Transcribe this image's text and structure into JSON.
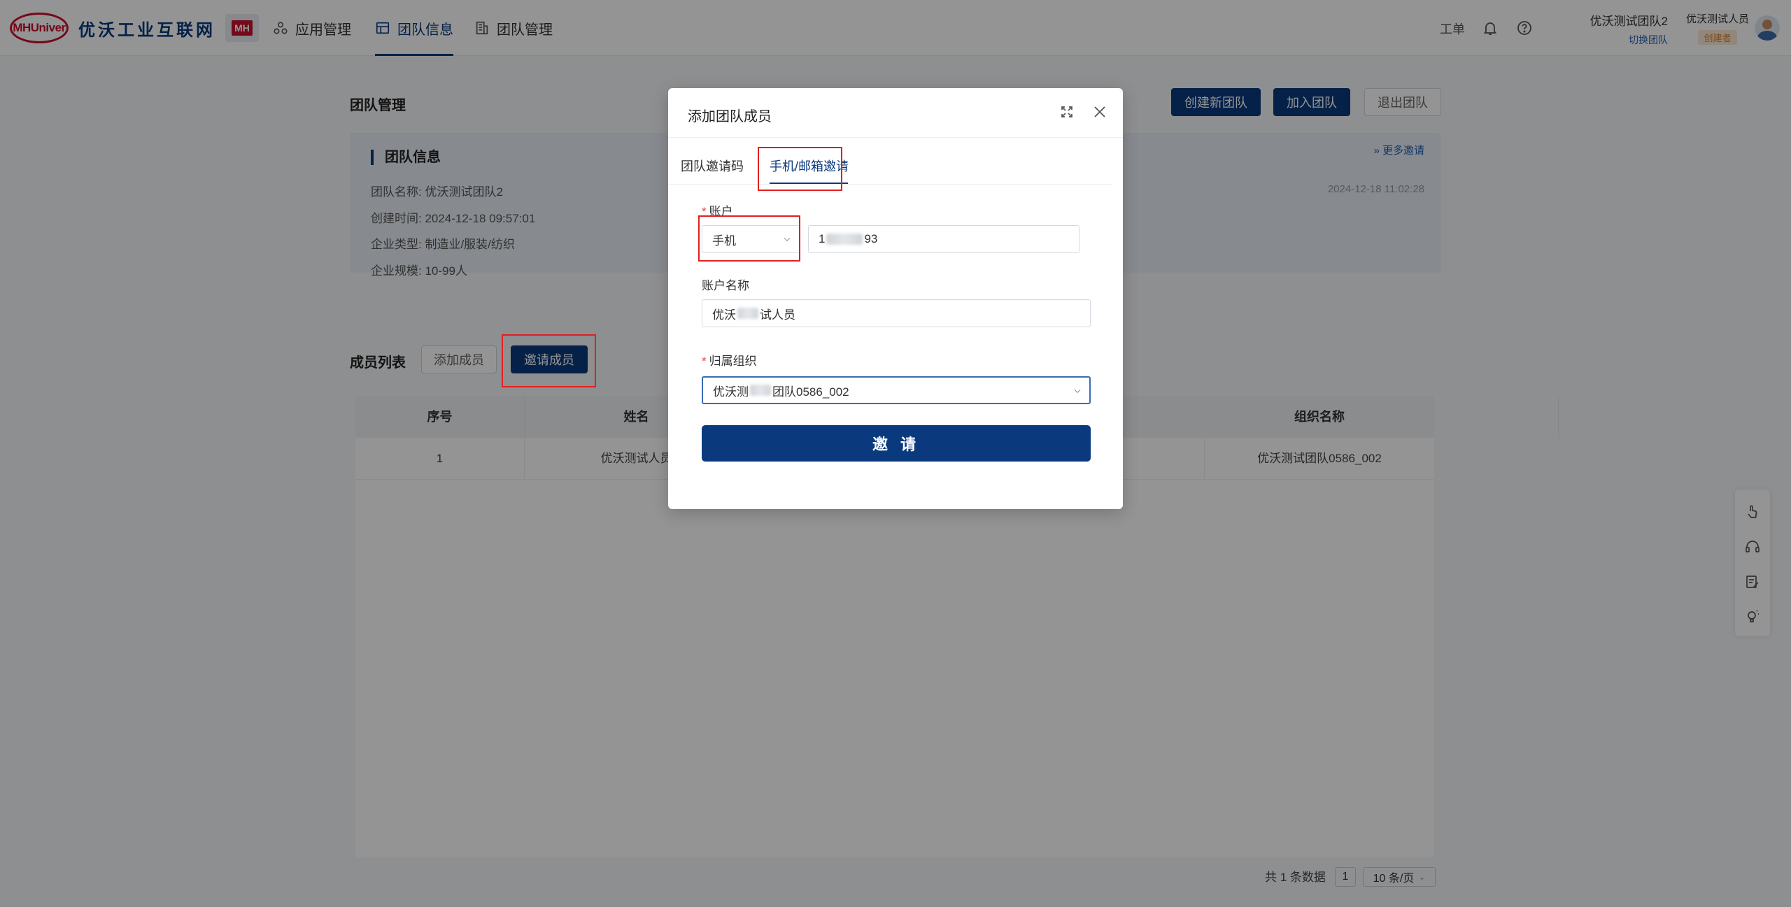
{
  "app": {
    "logo_mark": "MHUniver",
    "logo_text": "优沃工业互联网",
    "badge": "MH"
  },
  "nav": {
    "items": [
      {
        "label": "应用管理"
      },
      {
        "label": "团队信息"
      },
      {
        "label": "团队管理"
      }
    ],
    "work_order": "工单",
    "team_name": "优沃测试团队2",
    "switch_team": "切换团队",
    "user_name": "优沃测试人员",
    "user_role": "创建者"
  },
  "page": {
    "title": "团队管理",
    "buttons": {
      "create_team": "创建新团队",
      "join_team": "加入团队",
      "leave_team": "退出团队"
    }
  },
  "info": {
    "title": "团队信息",
    "team_name": "团队名称: 优沃测试团队2",
    "created": "创建时间: 2024-12-18 09:57:01",
    "industry": "企业类型: 制造业/服装/纺织",
    "scale": "企业规模: 10-99人",
    "more": "更多邀请",
    "right_time": "2024-12-18 11:02:28"
  },
  "members": {
    "title": "成员列表",
    "add_btn": "添加成员",
    "invite_btn": "邀请成员",
    "columns": [
      "序号",
      "姓名",
      "组织名称"
    ],
    "rows": [
      {
        "index": "1",
        "name": "优沃测试人员",
        "org": "优沃测试团队0586_002"
      }
    ],
    "pager": {
      "total": "共 1 条数据",
      "page": "1",
      "size": "10 条/页"
    }
  },
  "modal": {
    "title": "添加团队成员",
    "tabs": [
      "团队邀请码",
      "手机/邮箱邀请"
    ],
    "account_label": "账户",
    "account_type": "手机",
    "account_prefix": "1",
    "account_suffix": "93",
    "account_name_label": "账户名称",
    "account_name_prefix": "优沃",
    "account_name_suffix": "试人员",
    "org_label": "归属组织",
    "org_prefix": "优沃测",
    "org_suffix": "团队0586_002",
    "invite_btn": "邀 请"
  }
}
